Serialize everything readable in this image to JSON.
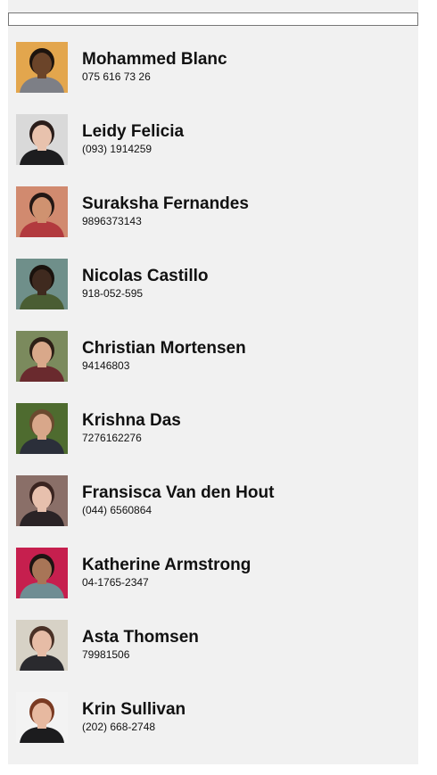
{
  "search": {
    "value": "",
    "placeholder": ""
  },
  "contacts": [
    {
      "name": "Mohammed Blanc",
      "phone": "075 616 73 26",
      "bg": "#e3a64d",
      "face": "#6b4429",
      "hair": "#1d140e",
      "shirt": "#7d7f86"
    },
    {
      "name": "Leidy Felicia",
      "phone": "(093) 1914259",
      "bg": "#d9d9d9",
      "face": "#e8c2ad",
      "hair": "#2a1d1a",
      "shirt": "#1d1d1f"
    },
    {
      "name": "Suraksha Fernandes",
      "phone": "9896373143",
      "bg": "#d18a6f",
      "face": "#cf9270",
      "hair": "#231714",
      "shirt": "#b23a3e"
    },
    {
      "name": "Nicolas Castillo",
      "phone": "918-052-595",
      "bg": "#6f8f8a",
      "face": "#3f2a1f",
      "hair": "#1a120d",
      "shirt": "#4a5d33"
    },
    {
      "name": "Christian Mortensen",
      "phone": "94146803",
      "bg": "#7b8a5d",
      "face": "#d9a88a",
      "hair": "#2d1f16",
      "shirt": "#6a2a2e"
    },
    {
      "name": "Krishna Das",
      "phone": "7276162276",
      "bg": "#4e6b2f",
      "face": "#d8a78a",
      "hair": "#6b4a2f",
      "shirt": "#2b2f3a"
    },
    {
      "name": "Fransisca Van den Hout",
      "phone": "(044) 6560864",
      "bg": "#8a6f68",
      "face": "#e7c0ad",
      "hair": "#3a2420",
      "shirt": "#2a2326"
    },
    {
      "name": "Katherine Armstrong",
      "phone": "04-1765-2347",
      "bg": "#c61f4e",
      "face": "#a87557",
      "hair": "#1d1412",
      "shirt": "#6f8d93"
    },
    {
      "name": "Asta Thomsen",
      "phone": "79981506",
      "bg": "#d7d2c6",
      "face": "#e6bca6",
      "hair": "#4a3126",
      "shirt": "#2a2a2e"
    },
    {
      "name": "Krin Sullivan",
      "phone": "(202) 668-2748",
      "bg": "#f3f3f3",
      "face": "#e7b9a0",
      "hair": "#7a3a22",
      "shirt": "#1c1c1e"
    }
  ]
}
